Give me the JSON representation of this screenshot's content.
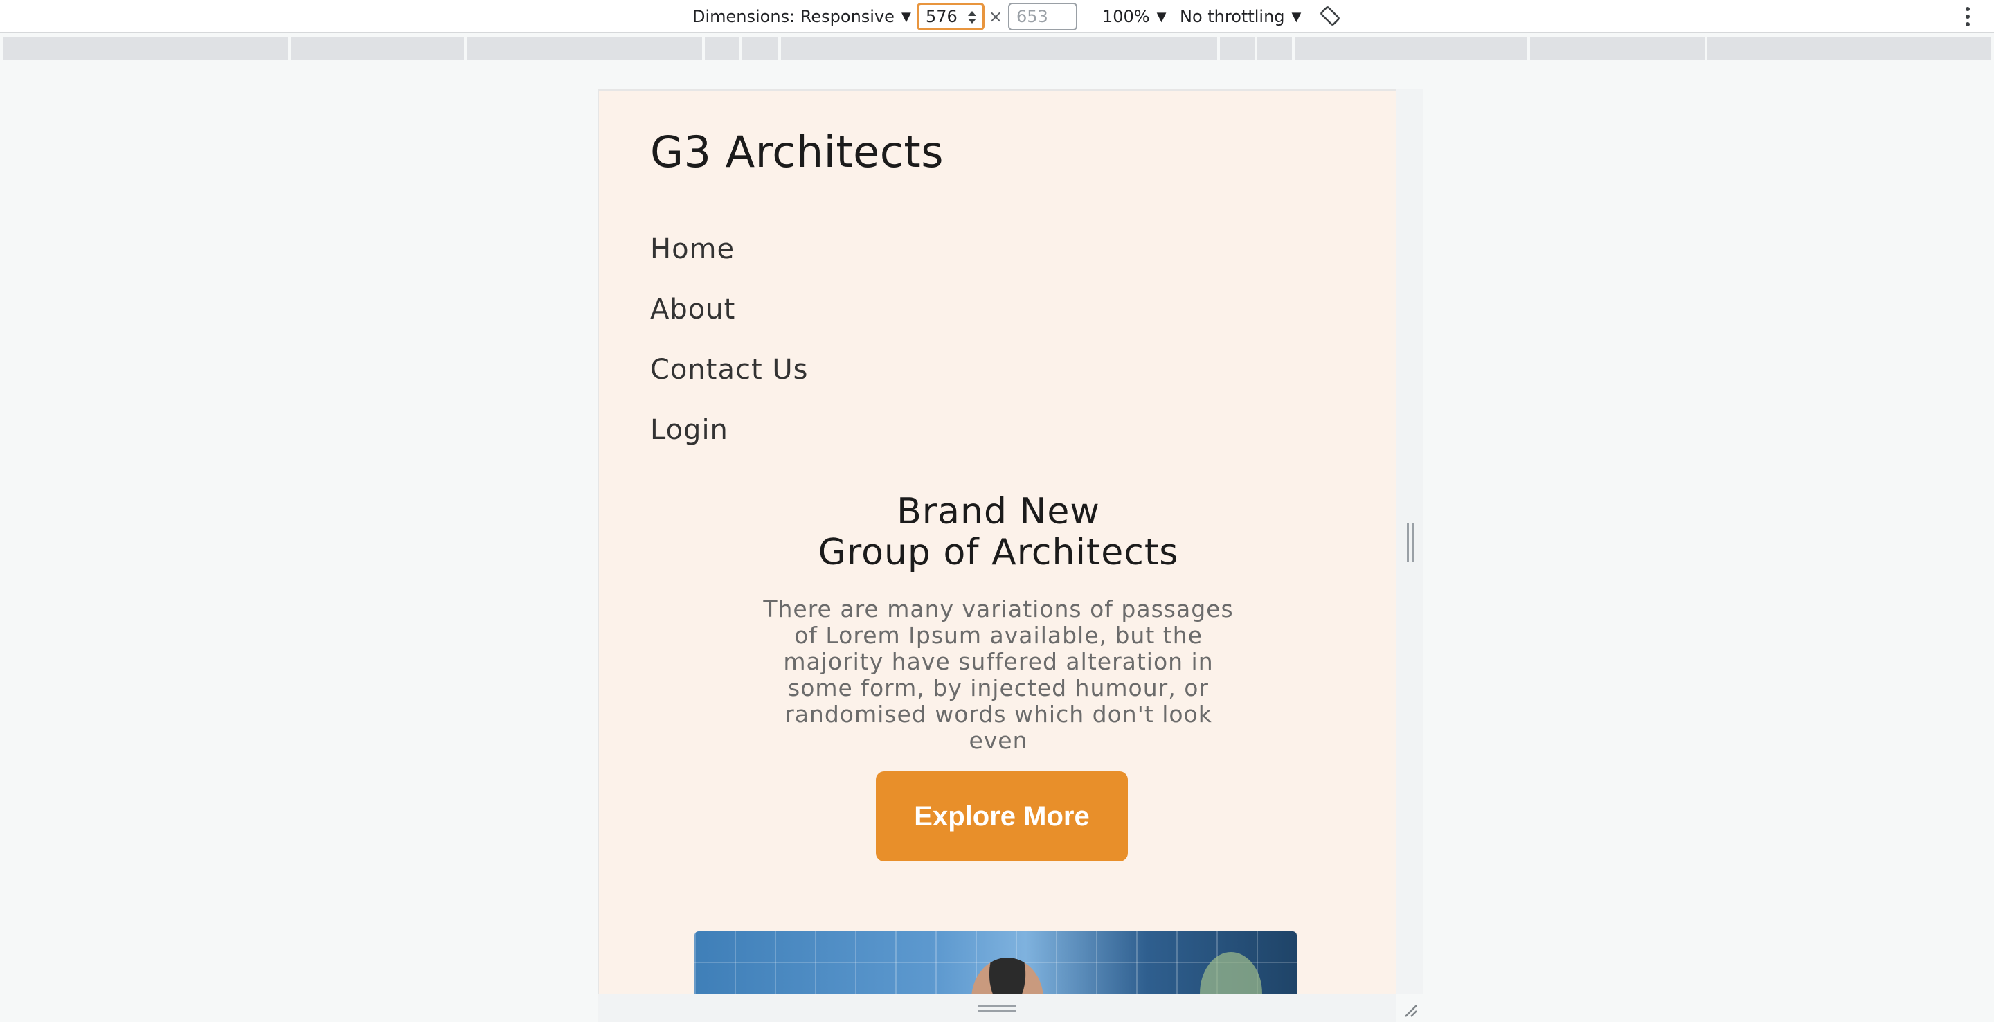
{
  "toolbar": {
    "dimensions_label": "Dimensions: Responsive",
    "width_value": "576",
    "height_placeholder": "653",
    "times_symbol": "×",
    "zoom": "100%",
    "throttling": "No throttling",
    "icons": {
      "caret": "chevron-down-icon",
      "stepper": "stepper-icon",
      "rotate": "rotate-icon",
      "more": "more-vert-icon"
    }
  },
  "site": {
    "logo": "G3 Architects",
    "nav": [
      "Home",
      "About",
      "Contact Us",
      "Login"
    ],
    "hero": {
      "title_line1": "Brand New",
      "title_line2": "Group of Architects",
      "text": "There are many variations of passages of Lorem Ipsum available, but the majority have suffered alteration in some form, by injected humour, or randomised words which don't look even",
      "button": "Explore More"
    }
  },
  "colors": {
    "page_bg": "#fcf2ea",
    "button_bg": "#e88f2a",
    "input_focus": "#e8953e",
    "devtools_bg": "#f6f8f8"
  }
}
